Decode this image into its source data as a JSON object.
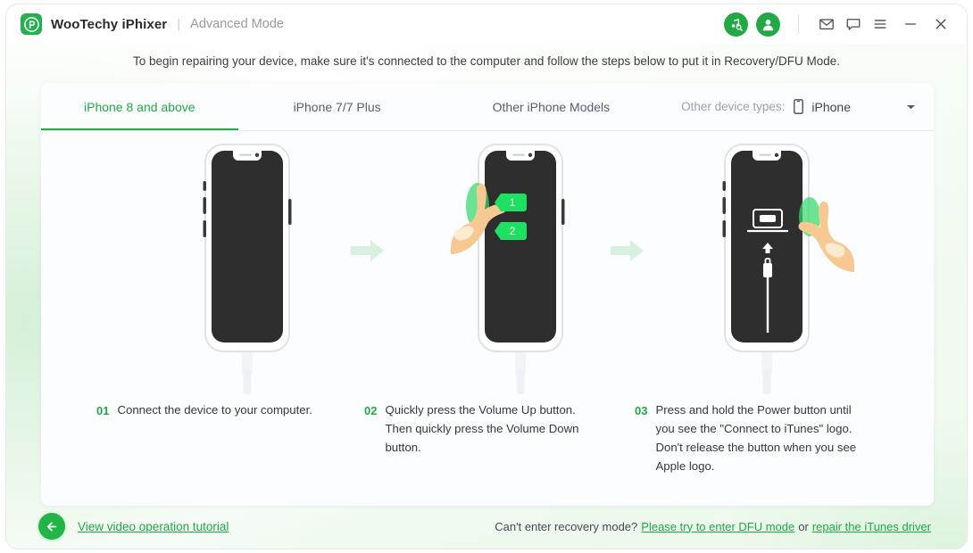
{
  "window": {
    "brand": "WooTechy iPhixer",
    "separator": "|",
    "mode": "Advanced Mode",
    "accent_color": "#22a845",
    "titlebar_icons": [
      {
        "name": "music-search-icon",
        "glyph": "music"
      },
      {
        "name": "user-account-icon",
        "glyph": "user"
      },
      {
        "name": "mail-icon",
        "glyph": "envelope"
      },
      {
        "name": "feedback-chat-icon",
        "glyph": "chat-bubble"
      },
      {
        "name": "menu-icon",
        "glyph": "hamburger"
      },
      {
        "name": "minimize-icon",
        "glyph": "minus"
      },
      {
        "name": "close-icon",
        "glyph": "cross"
      }
    ]
  },
  "instruction": "To begin repairing your device, make sure it's connected to the computer and follow the steps below to put it in Recovery/DFU Mode.",
  "tabs": [
    {
      "label": "iPhone 8 and above",
      "active": true
    },
    {
      "label": "iPhone 7/7 Plus",
      "active": false
    },
    {
      "label": "Other iPhone Models",
      "active": false
    }
  ],
  "device_types": {
    "label": "Other device types:",
    "selected": "iPhone",
    "icon": "phone-icon",
    "caret": "chevron-down-icon"
  },
  "steps": [
    {
      "number": "01",
      "text": "Connect the device to your computer.",
      "illustration": "iphone-plain-with-cable"
    },
    {
      "number": "02",
      "text": "Quickly press the Volume Up button. Then quickly press the Volume Down button.",
      "illustration": "iphone-hand-pressing-volume-buttons",
      "markers": [
        "1",
        "2"
      ]
    },
    {
      "number": "03",
      "text": "Press and hold the Power button until you see the \"Connect to iTunes\" logo. Don't release the button when you see Apple logo.",
      "illustration": "iphone-connect-to-itunes-screen"
    }
  ],
  "footer": {
    "back_button": "back-arrow-icon",
    "video_link": "View video operation tutorial",
    "question": "Can't enter recovery mode?",
    "dfu_link": "Please try to enter DFU mode",
    "conjunction": "or",
    "driver_link": "repair the iTunes driver"
  }
}
